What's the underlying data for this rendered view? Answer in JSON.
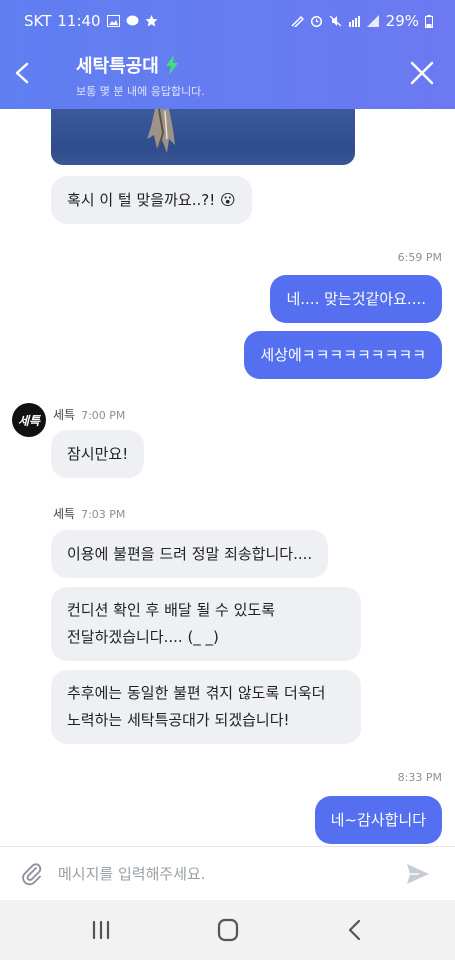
{
  "status_bar": {
    "carrier": "SKT",
    "time": "11:40",
    "battery": "29%"
  },
  "header": {
    "title": "세탁특공대",
    "subtitle": "보통 몇 분 내에 응답합니다."
  },
  "messages": [
    {
      "type": "in",
      "text": "혹시 이 털 맞을까요..?! 😮"
    },
    {
      "type": "time",
      "text": "6:59 PM"
    },
    {
      "type": "out",
      "text": "네.... 맞는것같아요...."
    },
    {
      "type": "out",
      "text": "세상에ㅋㅋㅋㅋㅋㅋㅋㅋㅋ"
    },
    {
      "type": "sender",
      "name": "세특",
      "time": "7:00 PM",
      "avatar": "세특"
    },
    {
      "type": "in",
      "text": "잠시만요!"
    },
    {
      "type": "sender",
      "name": "세특",
      "time": "7:03 PM"
    },
    {
      "type": "in",
      "text": "이용에 불편을 드려 정말 죄송합니다...."
    },
    {
      "type": "in",
      "line1": "컨디션 확인 후 배달 될 수 있도록",
      "line2": "전달하겠습니다.... (_ _)"
    },
    {
      "type": "in",
      "line1": "추후에는 동일한 불편 겪지 않도록 더욱더",
      "line2": "노력하는 세탁특공대가 되겠습니다!"
    },
    {
      "type": "time",
      "text": "8:33 PM"
    },
    {
      "type": "out",
      "text": "네~감사합니다"
    }
  ],
  "input": {
    "placeholder": "메시지를 입력해주세요."
  },
  "colors": {
    "header": "#5f7ff1",
    "outgoing_bubble": "#5470f0",
    "incoming_bubble": "#eef0f3"
  },
  "icons": [
    "back-arrow-icon",
    "lightning-icon",
    "close-icon",
    "paperclip-icon",
    "send-icon",
    "recent-apps-icon",
    "home-icon",
    "nav-back-icon"
  ]
}
